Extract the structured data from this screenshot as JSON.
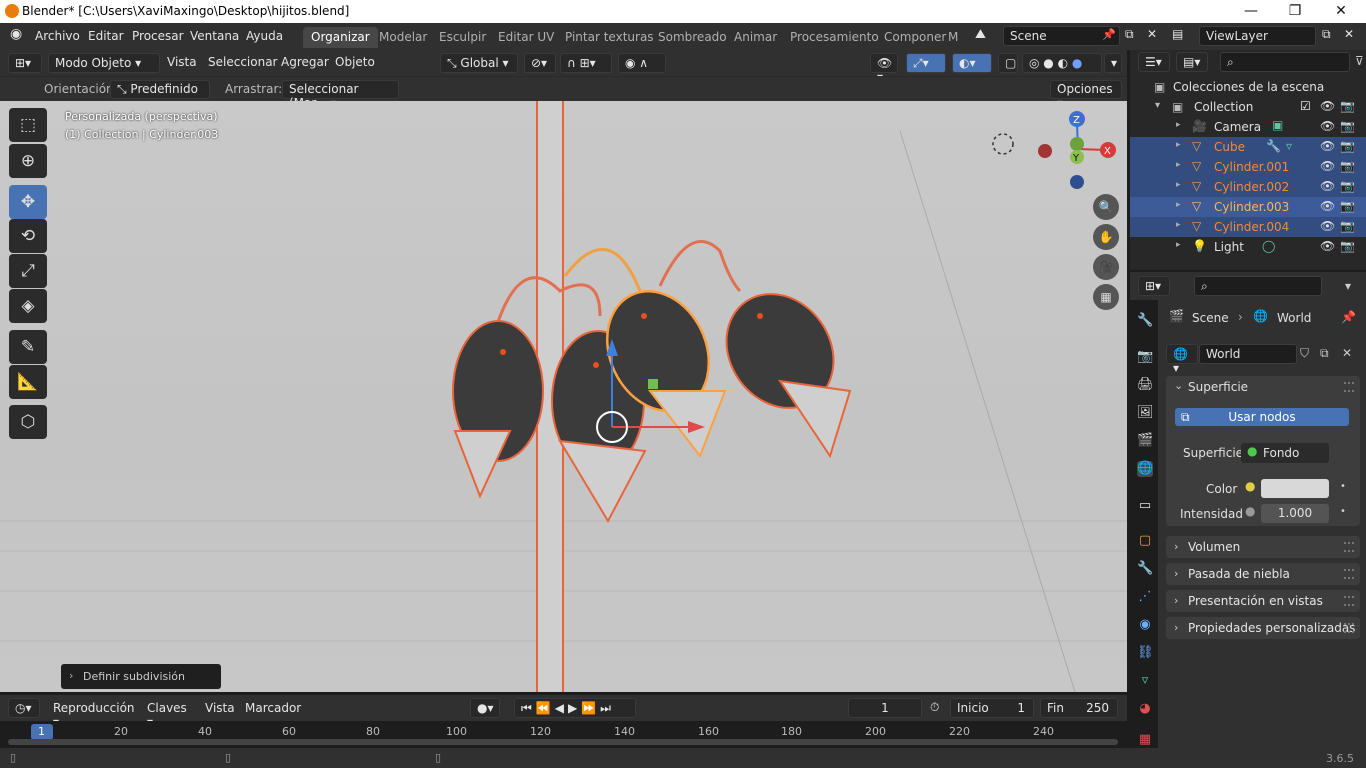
{
  "title": "Blender* [C:\\Users\\XaviMaxingo\\Desktop\\hijitos.blend]",
  "window_buttons": {
    "minimize": "—",
    "maximize": "❐",
    "close": "✕"
  },
  "menu": [
    "Archivo",
    "Editar",
    "Procesar",
    "Ventana",
    "Ayuda"
  ],
  "workspaces": [
    "Organizar",
    "Modelar",
    "Esculpir",
    "Editar UV",
    "Pintar texturas",
    "Sombreado",
    "Animar",
    "Procesamiento",
    "Componer",
    "M"
  ],
  "scene": "Scene",
  "view_layer": "ViewLayer",
  "viewport_header": {
    "mode": "Modo Objeto",
    "menus": [
      "Vista",
      "Seleccionar",
      "Agregar",
      "Objeto"
    ],
    "transform": "Global"
  },
  "tool_settings": {
    "orientation_label": "Orientación:",
    "orientation_value": "Predefinido",
    "drag_label": "Arrastrar:",
    "drag_value": "Seleccionar (Mar...",
    "options": "Opciones"
  },
  "viewport": {
    "view_name": "Personalizada (perspectiva)",
    "collection_info": "(1) Collection | Cylinder.003",
    "operator_panel": "Definir subdivisión",
    "gizmo_axes": {
      "z": "Z",
      "y": "Y",
      "x": "X"
    }
  },
  "outliner": {
    "header": "Colecciones de la escena",
    "collection": "Collection",
    "items": [
      {
        "name": "Camera",
        "selected": false,
        "color": "#e6e6e6"
      },
      {
        "name": "Cube",
        "selected": true,
        "color": "#f08a3a"
      },
      {
        "name": "Cylinder.001",
        "selected": true,
        "color": "#f08a3a"
      },
      {
        "name": "Cylinder.002",
        "selected": true,
        "color": "#f08a3a"
      },
      {
        "name": "Cylinder.003",
        "selected": true,
        "active": true,
        "color": "#ffb060"
      },
      {
        "name": "Cylinder.004",
        "selected": true,
        "color": "#f08a3a"
      },
      {
        "name": "Light",
        "selected": false,
        "color": "#e6e6e6"
      }
    ]
  },
  "properties": {
    "breadcrumb_scene": "Scene",
    "breadcrumb_world": "World",
    "world_name": "World",
    "surface_panel": "Superficie",
    "use_nodes": "Usar nodos",
    "surface_label": "Superficie",
    "surface_value": "Fondo",
    "color_label": "Color",
    "strength_label": "Intensidad",
    "strength_value": "1.000",
    "panels": [
      "Volumen",
      "Pasada de niebla",
      "Presentación en vistas",
      "Propiedades personalizadas"
    ]
  },
  "timeline": {
    "playback": "Reproducción",
    "keys": "Claves",
    "view": "Vista",
    "marker": "Marcador",
    "current_frame": "1",
    "start_label": "Inicio",
    "start": "1",
    "end_label": "Fin",
    "end": "250",
    "ruler": [
      "1",
      "20",
      "40",
      "60",
      "80",
      "100",
      "120",
      "140",
      "160",
      "180",
      "200",
      "220",
      "240"
    ]
  },
  "version": "3.6.5",
  "colors": {
    "accent": "#4772b3",
    "selected_outline": "#f07b3f",
    "active_outline": "#ffa040"
  }
}
